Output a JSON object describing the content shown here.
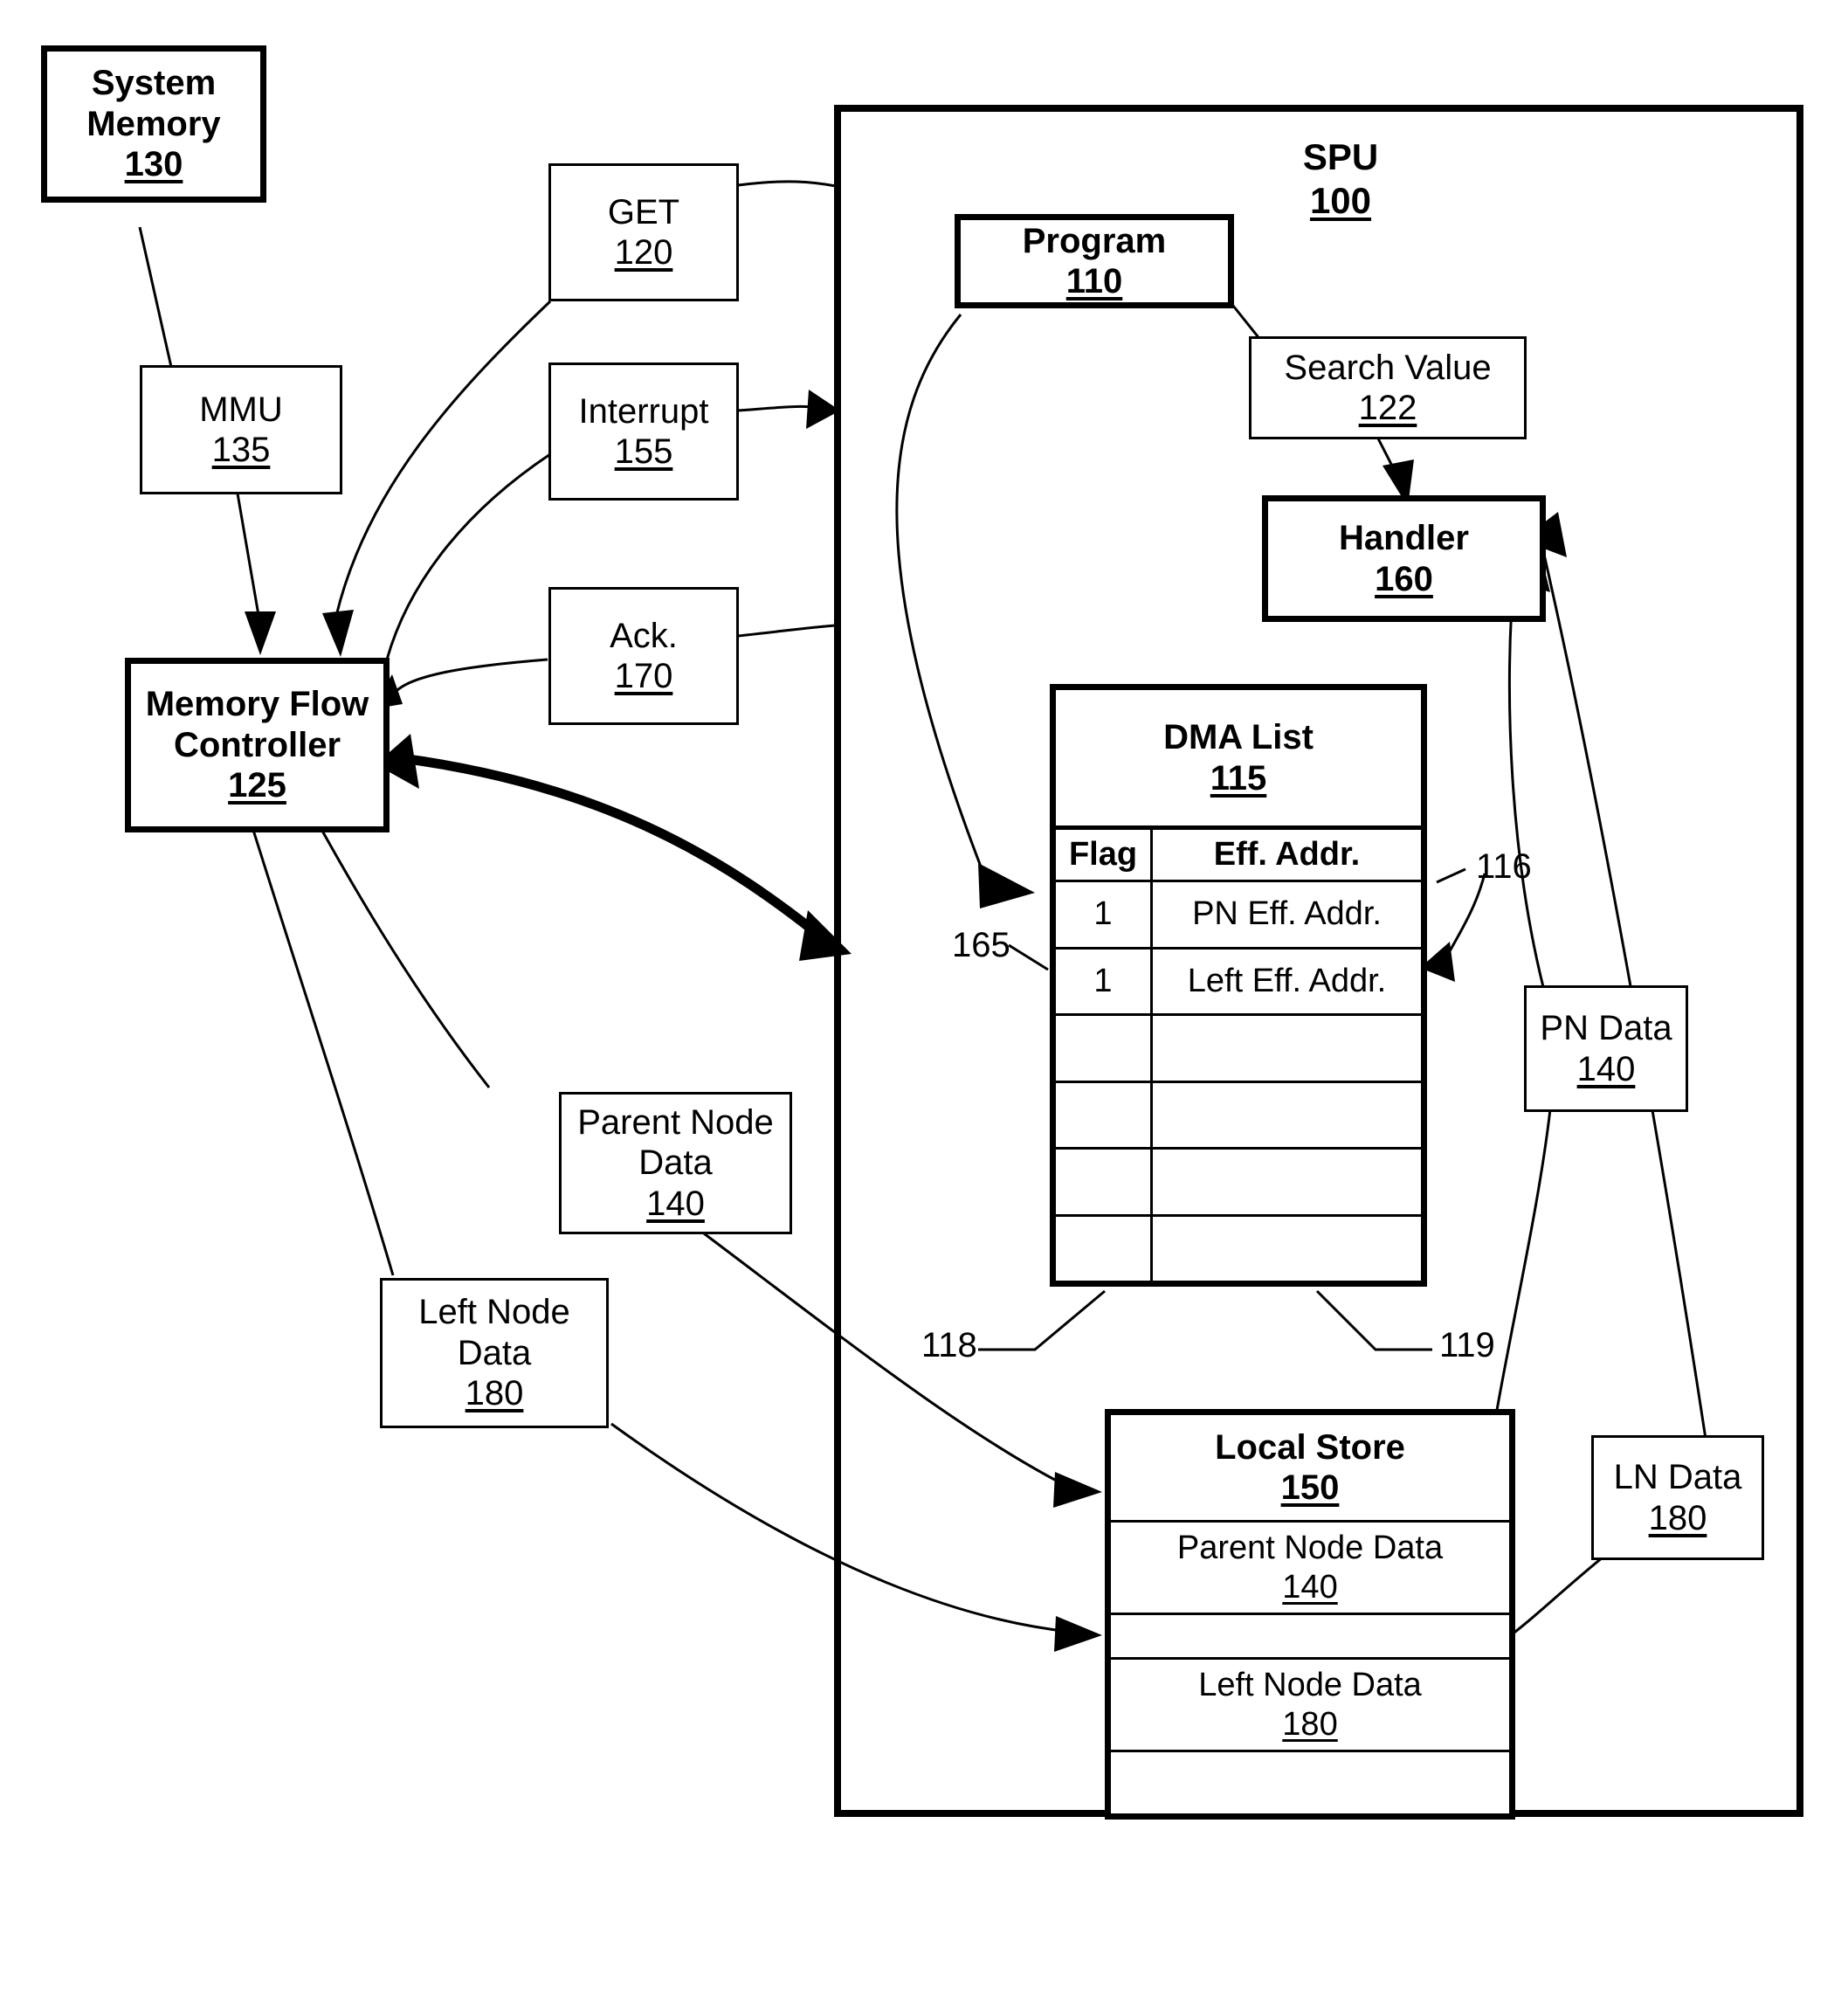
{
  "diagram": {
    "title": "SPU DMA list search data flow",
    "ink_color": "#000000",
    "background_color": "#ffffff"
  },
  "blocks": {
    "system_memory": {
      "label": "System Memory",
      "ref": "130"
    },
    "mmu": {
      "label": "MMU",
      "ref": "135"
    },
    "get": {
      "label": "GET",
      "ref": "120"
    },
    "interrupt": {
      "label": "Interrupt",
      "ref": "155"
    },
    "ack": {
      "label": "Ack.",
      "ref": "170"
    },
    "mfc": {
      "label_line1": "Memory Flow",
      "label_line2": "Controller",
      "ref": "125"
    },
    "parent_node_data": {
      "label_line1": "Parent Node",
      "label_line2": "Data",
      "ref": "140"
    },
    "left_node_data": {
      "label_line1": "Left Node",
      "label_line2": "Data",
      "ref": "180"
    },
    "program": {
      "label": "Program",
      "ref": "110"
    },
    "search_value": {
      "label": "Search Value",
      "ref": "122"
    },
    "handler": {
      "label": "Handler",
      "ref": "160"
    },
    "pn_data": {
      "label": "PN Data",
      "ref": "140"
    },
    "ln_data": {
      "label": "LN Data",
      "ref": "180"
    }
  },
  "spu": {
    "label": "SPU",
    "ref": "100"
  },
  "dma_list": {
    "title": "DMA List",
    "ref": "115",
    "columns": [
      "Flag",
      "Eff. Addr."
    ],
    "rows": [
      {
        "flag": "1",
        "addr": "PN Eff. Addr."
      },
      {
        "flag": "1",
        "addr": "Left Eff. Addr."
      },
      {
        "flag": "",
        "addr": ""
      },
      {
        "flag": "",
        "addr": ""
      },
      {
        "flag": "",
        "addr": ""
      },
      {
        "flag": "",
        "addr": ""
      }
    ]
  },
  "local_store": {
    "title": "Local Store",
    "ref": "150",
    "segments": [
      {
        "label": "Parent Node Data",
        "ref": "140"
      },
      {
        "label": "",
        "ref": ""
      },
      {
        "label": "Left Node Data",
        "ref": "180"
      },
      {
        "label": "",
        "ref": ""
      }
    ]
  },
  "reference_labels": {
    "r165": "165",
    "r116": "116",
    "r118": "118",
    "r119": "119"
  }
}
